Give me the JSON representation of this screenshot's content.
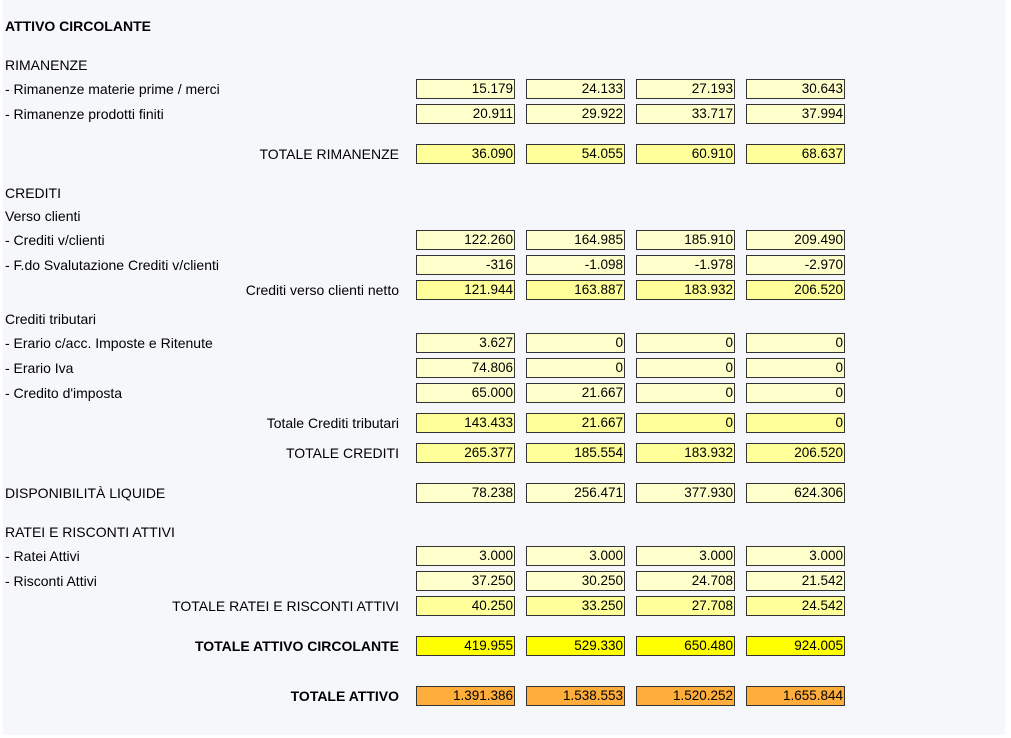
{
  "section_title": "ATTIVO CIRCOLANTE",
  "headers": {
    "rimanenze": "RIMANENZE",
    "crediti": "CREDITI",
    "verso_clienti": "Verso clienti",
    "crediti_tributari": "Crediti tributari",
    "ratei": "RATEI E RISCONTI ATTIVI"
  },
  "rows": {
    "rim_materie": {
      "label": "- Rimanenze materie prime / merci",
      "values": [
        "15.179",
        "24.133",
        "27.193",
        "30.643"
      ]
    },
    "rim_prodotti": {
      "label": "- Rimanenze prodotti finiti",
      "values": [
        "20.911",
        "29.922",
        "33.717",
        "37.994"
      ]
    },
    "tot_rimanenze": {
      "label": "TOTALE RIMANENZE",
      "values": [
        "36.090",
        "54.055",
        "60.910",
        "68.637"
      ]
    },
    "crediti_clienti": {
      "label": "- Crediti v/clienti",
      "values": [
        "122.260",
        "164.985",
        "185.910",
        "209.490"
      ]
    },
    "fondo_svalutazione": {
      "label": "- F.do Svalutazione Crediti v/clienti",
      "values": [
        "-316",
        "-1.098",
        "-1.978",
        "-2.970"
      ]
    },
    "crediti_netto": {
      "label": "Crediti verso clienti netto",
      "values": [
        "121.944",
        "163.887",
        "183.932",
        "206.520"
      ]
    },
    "erario_acc": {
      "label": "- Erario c/acc. Imposte e Ritenute",
      "values": [
        "3.627",
        "0",
        "0",
        "0"
      ]
    },
    "erario_iva": {
      "label": "- Erario Iva",
      "values": [
        "74.806",
        "0",
        "0",
        "0"
      ]
    },
    "credito_imposta": {
      "label": "- Credito d'imposta",
      "values": [
        "65.000",
        "21.667",
        "0",
        "0"
      ]
    },
    "tot_tributari": {
      "label": "Totale Crediti tributari",
      "values": [
        "143.433",
        "21.667",
        "0",
        "0"
      ]
    },
    "tot_crediti": {
      "label": "TOTALE CREDITI",
      "values": [
        "265.377",
        "185.554",
        "183.932",
        "206.520"
      ]
    },
    "disponibilita": {
      "label": "DISPONIBILITÀ LIQUIDE",
      "values": [
        "78.238",
        "256.471",
        "377.930",
        "624.306"
      ]
    },
    "ratei_attivi": {
      "label": "- Ratei Attivi",
      "values": [
        "3.000",
        "3.000",
        "3.000",
        "3.000"
      ]
    },
    "risconti_attivi": {
      "label": "- Risconti Attivi",
      "values": [
        "37.250",
        "30.250",
        "24.708",
        "21.542"
      ]
    },
    "tot_ratei": {
      "label": "TOTALE RATEI E RISCONTI ATTIVI",
      "values": [
        "40.250",
        "33.250",
        "27.708",
        "24.542"
      ]
    },
    "tot_circolante": {
      "label": "TOTALE ATTIVO CIRCOLANTE",
      "values": [
        "419.955",
        "529.330",
        "650.480",
        "924.005"
      ]
    },
    "tot_attivo": {
      "label": "TOTALE ATTIVO",
      "values": [
        "1.391.386",
        "1.538.553",
        "1.520.252",
        "1.655.844"
      ]
    }
  },
  "colors": {
    "input_cell": "#ffffcc",
    "total_cell": "#ffff99",
    "grand_total_cell": "#ffff00",
    "attivo_cell": "#ffad3b",
    "panel_bg": "#f6f7fb"
  }
}
